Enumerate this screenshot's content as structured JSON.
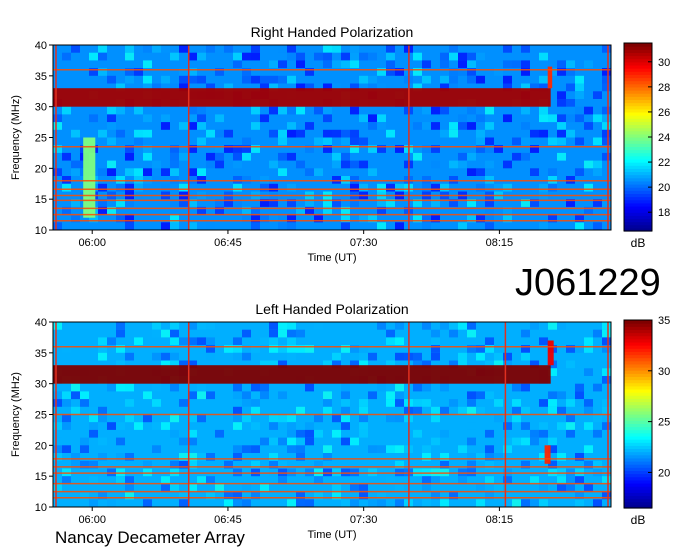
{
  "observation_id": "J061229",
  "instrument": "Nancay Decameter Array",
  "colors": {
    "colormap": [
      "#00008f",
      "#0000ff",
      "#007fff",
      "#00ffff",
      "#7fff7f",
      "#ffff00",
      "#ff7f00",
      "#ff0000",
      "#7f0000"
    ],
    "marker_line": "#e03020",
    "background": "#ffffff"
  },
  "chart_data": [
    {
      "type": "heatmap",
      "title": "Right Handed Polarization",
      "xlabel": "Time (UT)",
      "ylabel": "Frequency (MHz)",
      "x_ticks": [
        "06:00",
        "06:45",
        "07:30",
        "08:15"
      ],
      "x_tick_minutes": [
        360,
        405,
        450,
        495
      ],
      "xlim_minutes": [
        347,
        532
      ],
      "y_ticks": [
        10,
        15,
        20,
        25,
        30,
        35,
        40
      ],
      "ylim": [
        10,
        40
      ],
      "colorbar": {
        "label": "dB",
        "ticks": [
          18,
          20,
          22,
          24,
          26,
          28,
          30
        ],
        "range": [
          16.5,
          31.5
        ]
      },
      "background_db": 20.5,
      "features": [
        {
          "name": "emission band",
          "freq": [
            30,
            33
          ],
          "start_min": 347,
          "end_min": 512,
          "db": 31
        },
        {
          "name": "band rise",
          "freq": [
            33,
            36.5
          ],
          "start_min": 511,
          "end_min": 512.5,
          "db": 29
        },
        {
          "name": "burst",
          "freq": [
            12,
            25
          ],
          "start_min": 357,
          "end_min": 361,
          "db": 24
        }
      ],
      "horizontal_lines_mhz": [
        11.5,
        12.5,
        13.5,
        14.8,
        15.6,
        16.6,
        18.0,
        23.5,
        36.0
      ],
      "vertical_lines_min": [
        348,
        392,
        465,
        531
      ]
    },
    {
      "type": "heatmap",
      "title": "Left Handed Polarization",
      "xlabel": "Time (UT)",
      "ylabel": "Frequency (MHz)",
      "x_ticks": [
        "06:00",
        "06:45",
        "07:30",
        "08:15"
      ],
      "x_tick_minutes": [
        360,
        405,
        450,
        495
      ],
      "xlim_minutes": [
        347,
        532
      ],
      "y_ticks": [
        10,
        15,
        20,
        25,
        30,
        35,
        40
      ],
      "ylim": [
        10,
        40
      ],
      "colorbar": {
        "label": "dB",
        "ticks": [
          20,
          25,
          30,
          35
        ],
        "range": [
          16.5,
          35
        ]
      },
      "background_db": 22,
      "features": [
        {
          "name": "emission band",
          "freq": [
            30,
            33
          ],
          "start_min": 347,
          "end_min": 512,
          "db": 35
        },
        {
          "name": "band rise",
          "freq": [
            33,
            37
          ],
          "start_min": 511,
          "end_min": 513,
          "db": 33
        },
        {
          "name": "burst",
          "freq": [
            17,
            20
          ],
          "start_min": 510,
          "end_min": 512,
          "db": 32
        }
      ],
      "horizontal_lines_mhz": [
        11.5,
        12.5,
        13.8,
        15.5,
        16.5,
        17.8,
        25.0,
        36.0
      ],
      "vertical_lines_min": [
        348,
        392,
        465,
        497,
        531
      ]
    }
  ]
}
